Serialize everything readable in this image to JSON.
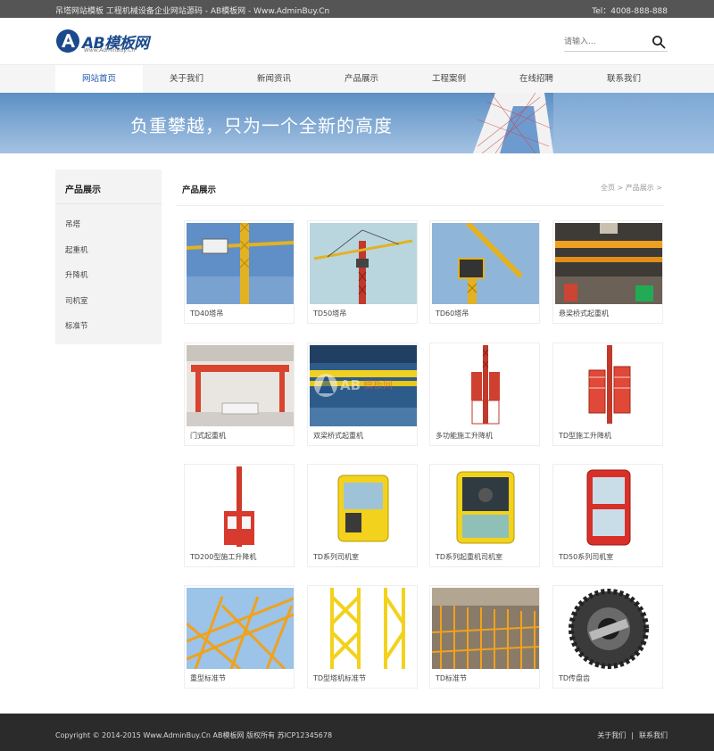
{
  "topbar": {
    "site_desc": "吊塔网站模板 工程机械设备企业网站源码 - AB模板网 - Www.AdminBuy.Cn",
    "tel": "Tel：4008-888-888"
  },
  "logo": {
    "text": "AB模板网",
    "sub": "Www.AdminBuy.Cn"
  },
  "search": {
    "placeholder": "请输入..."
  },
  "nav": [
    "网站首页",
    "关于我们",
    "新闻资讯",
    "产品展示",
    "工程案例",
    "在线招聘",
    "联系我们"
  ],
  "banner": {
    "slogan": "负重攀越，只为一个全新的高度"
  },
  "sidebar": {
    "title": "产品展示",
    "items": [
      "吊塔",
      "起重机",
      "升降机",
      "司机室",
      "标准节"
    ]
  },
  "main": {
    "title": "产品展示",
    "breadcrumb": "全页 > 产品展示 >"
  },
  "products": [
    {
      "name": "TD40塔吊"
    },
    {
      "name": "TD50塔吊"
    },
    {
      "name": "TD60塔吊"
    },
    {
      "name": "悬梁桥式起重机"
    },
    {
      "name": "门式起重机"
    },
    {
      "name": "双梁桥式起重机"
    },
    {
      "name": "多功能施工升降机"
    },
    {
      "name": "TD型施工升降机"
    },
    {
      "name": "TD200型施工升降机"
    },
    {
      "name": "TD系列司机室"
    },
    {
      "name": "TD系列起重机司机室"
    },
    {
      "name": "TD50系列司机室"
    },
    {
      "name": "重型标准节"
    },
    {
      "name": "TD型塔机标准节"
    },
    {
      "name": "TD标准节"
    },
    {
      "name": "TD传盘齿"
    }
  ],
  "footer": {
    "copyright": "Copyright © 2014-2015 Www.AdminBuy.Cn AB模板网 版权所有   苏ICP12345678",
    "links": [
      "关于我们",
      "联系我们"
    ]
  },
  "colors": {
    "accent": "#1a56a8",
    "topbar": "#555555",
    "footer": "#2b2b2b",
    "sidebar_bg": "#f3f3f3"
  }
}
